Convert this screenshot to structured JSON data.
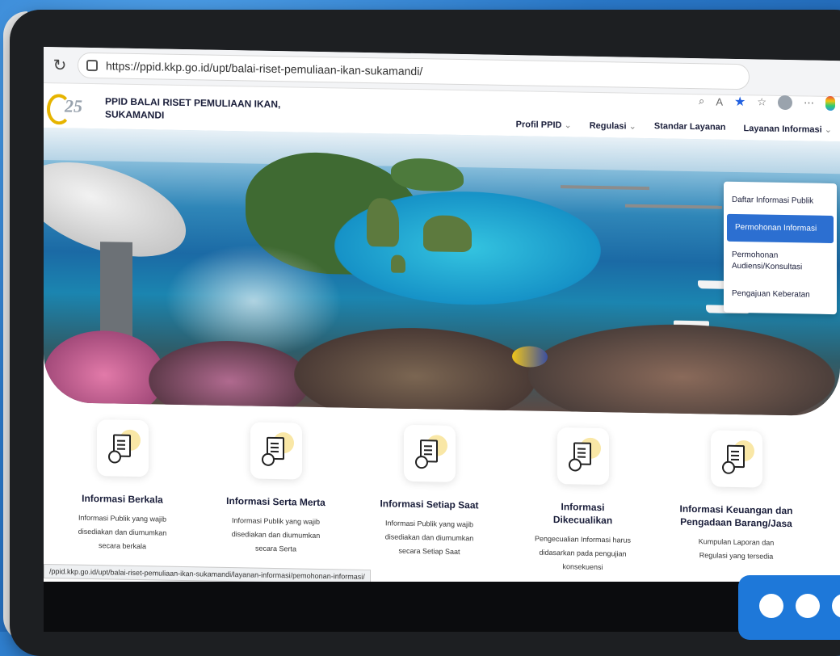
{
  "browser": {
    "url": "https://ppid.kkp.go.id/upt/balai-riset-pemuliaan-ikan-sukamandi/",
    "status_url": "/ppid.kkp.go.id/upt/balai-riset-pemuliaan-ikan-sukamandi/layanan-informasi/pemohonan-informasi/"
  },
  "site": {
    "title": "PPID BALAI RISET PEMULIAAN IKAN, SUKAMANDI"
  },
  "nav": {
    "items": [
      "Profil PPID",
      "Regulasi",
      "Standar Layanan",
      "Layanan Informasi"
    ]
  },
  "dropdown": {
    "items": [
      "Daftar Informasi Publik",
      "Permohonan Informasi",
      "Permohonan Audiensi/Konsultasi",
      "Pengajuan Keberatan"
    ],
    "active_index": 1
  },
  "cards": [
    {
      "title": "Informasi Berkala",
      "desc": "Informasi Publik yang wajib disediakan dan diumumkan secara berkala"
    },
    {
      "title": "Informasi Serta Merta",
      "desc": "Informasi Publik yang wajib disediakan dan diumumkan secara Serta"
    },
    {
      "title": "Informasi Setiap Saat",
      "desc": "Informasi Publik yang wajib disediakan dan diumumkan secara Setiap Saat"
    },
    {
      "title": "Informasi Dikecualikan",
      "desc": "Pengecualian Informasi harus didasarkan pada pengujian konsekuensi"
    },
    {
      "title": "Informasi Keuangan dan Pengadaan Barang/Jasa",
      "desc": "Kumpulan Laporan dan Regulasi yang tersedia"
    }
  ],
  "colors": {
    "background": "#2f7fcf",
    "accent": "#2c6fd1",
    "card_sun": "#f9e7a6"
  }
}
